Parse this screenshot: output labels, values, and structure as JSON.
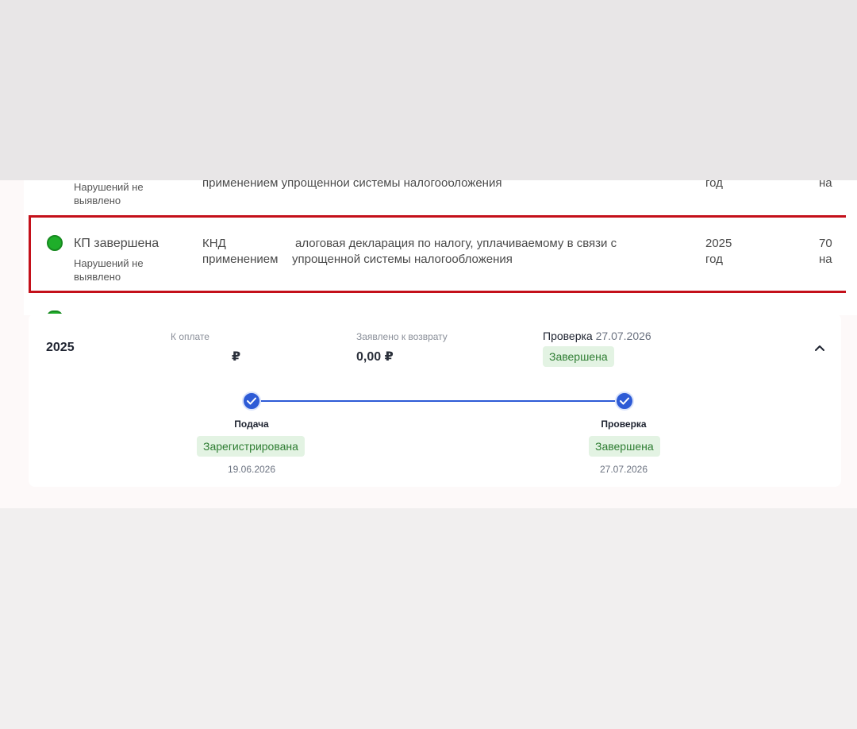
{
  "table": {
    "prev_row": {
      "violations": "Нарушений не",
      "violations2": "выявлено",
      "description": "применением упрощенной системы налогообложения",
      "period": "год",
      "extra": "на"
    },
    "highlighted_row": {
      "status": "КП завершена",
      "violations": "Нарушений не",
      "violations2": "выявлено",
      "code": "КНД",
      "code2": "применением",
      "description": "алоговая декларация по налогу, уплачиваемому в связи с",
      "description2": "упрощенной системы налогообложения",
      "period_year": "2025",
      "period_unit": "год",
      "extra": "70",
      "extra2": "на"
    }
  },
  "card": {
    "year": "2025",
    "to_pay_label": "К оплате",
    "to_pay_value": "₽",
    "refund_label": "Заявлено к возврату",
    "refund_value": "0,00 ₽",
    "check_label": "Проверка",
    "check_date": "27.07.2026",
    "check_status": "Завершена",
    "timeline": {
      "steps": [
        {
          "label": "Подача",
          "status": "Зарегистрирована",
          "date": "19.06.2026"
        },
        {
          "label": "Проверка",
          "status": "Завершена",
          "date": "27.07.2026"
        }
      ]
    }
  },
  "colors": {
    "highlight_border": "#c4101a",
    "status_green": "#1fae2a",
    "timeline_blue": "#2d5bd6",
    "badge_bg": "#e3f3e3",
    "badge_text": "#2e7d32"
  },
  "icons": {
    "status": "status-dot-icon",
    "chevron": "chevron-up-icon",
    "step": "check-circle-icon"
  }
}
